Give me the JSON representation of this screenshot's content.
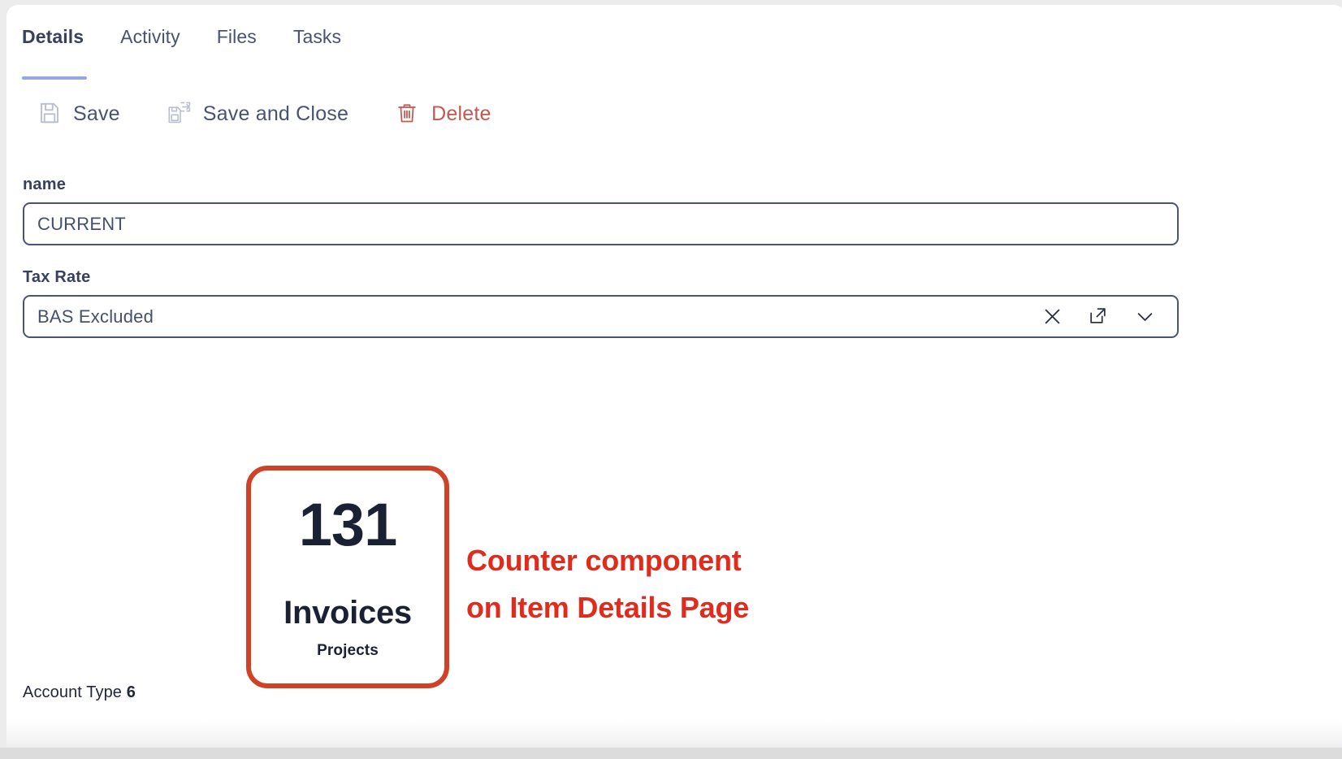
{
  "tabs": [
    {
      "label": "Details",
      "active": true
    },
    {
      "label": "Activity",
      "active": false
    },
    {
      "label": "Files",
      "active": false
    },
    {
      "label": "Tasks",
      "active": false
    }
  ],
  "toolbar": {
    "save_label": "Save",
    "save_close_label": "Save and Close",
    "delete_label": "Delete"
  },
  "form": {
    "name": {
      "label": "name",
      "value": "CURRENT"
    },
    "tax_rate": {
      "label": "Tax Rate",
      "value": "BAS Excluded"
    }
  },
  "counter": {
    "value": "131",
    "title": "Invoices",
    "subtitle": "Projects"
  },
  "annotation": {
    "line1": "Counter component",
    "line2": "on Item Details Page"
  },
  "footer": {
    "status_label": "Account Type",
    "status_value": "6"
  },
  "colors": {
    "accent_red": "#cf4227",
    "annotation_red": "#e02b1d",
    "delete_red": "#c4584f",
    "tab_active_underline": "#9aa6de",
    "text_dark": "#1b2135",
    "border_dark": "#4b5472"
  },
  "icons": {
    "save": "floppy-disk-icon",
    "save_and_close": "floppy-disk-exit-icon",
    "delete": "trash-icon",
    "clear": "close-icon",
    "open": "external-link-icon",
    "expand": "chevron-down-icon"
  }
}
